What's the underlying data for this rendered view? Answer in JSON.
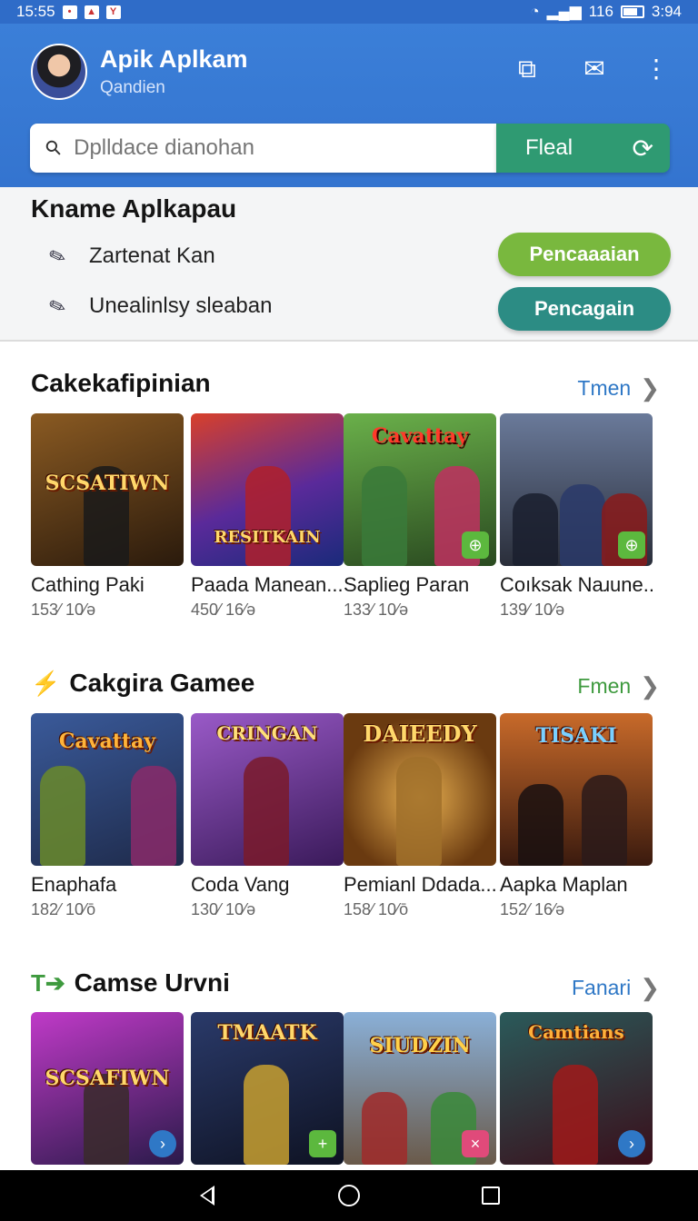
{
  "status_bar": {
    "time": "15:55",
    "signal": "116",
    "clock": "3:94"
  },
  "header": {
    "title": "Apik Aplkam",
    "subtitle": "Qandien",
    "search_placeholder": "Dplldace dianohan",
    "search_button": "Fleal",
    "icons": [
      "chat-icon",
      "mail-icon",
      "more-icon"
    ]
  },
  "filter": {
    "title": "Kname Aplkapau",
    "rows": [
      {
        "label": "Zartenat Kan",
        "button": "Pencaaaian",
        "button_color": "#79b83e"
      },
      {
        "label": "Unealinlsy sleaban",
        "button": "Pencagain",
        "button_color": "#2c8c84"
      }
    ]
  },
  "sections": [
    {
      "title": "Cakekafipinian",
      "icon": "",
      "see_more": "Tmen",
      "see_more_color": "#2f78c6",
      "items": [
        {
          "name": "Cathing Paki",
          "meta": "153⁄ 10⁄ə",
          "art": "SCSATIWN",
          "bg": "#5a3a1c",
          "badge": ""
        },
        {
          "name": "Paada Manean...",
          "meta": "450⁄ 16⁄ə",
          "art": "RESITKAIN",
          "bg": "#6a2a8a",
          "badge": ""
        },
        {
          "name": "Saplieg Paran",
          "meta": "133⁄ 10⁄ə",
          "art": "Cavattay",
          "bg": "#3f7a3b",
          "badge": "+"
        },
        {
          "name": "Coıksak Naɹune...",
          "meta": "139⁄ 10⁄ə",
          "art": "",
          "bg": "#3d4a5e",
          "badge": "+"
        }
      ]
    },
    {
      "title": "Cakgira Gamee",
      "icon": "⚡",
      "see_more": "Fmen",
      "see_more_color": "#3e9a3e",
      "items": [
        {
          "name": "Enaphafa",
          "meta": "182⁄ 10⁄ō",
          "art": "Cavattay",
          "bg": "#2f3e6a",
          "badge": ""
        },
        {
          "name": "Coda Vang",
          "meta": "130⁄ 10⁄ə",
          "art": "CRINGAN",
          "bg": "#5b2f7a",
          "badge": ""
        },
        {
          "name": "Pemianl Ddada...",
          "meta": "158⁄ 10⁄ō",
          "art": "DAIEEDY",
          "bg": "#6a4a1c",
          "badge": ""
        },
        {
          "name": "Aapka Maplan",
          "meta": "152⁄ 16⁄ə",
          "art": "TISAKI",
          "bg": "#7a3a1e",
          "badge": ""
        }
      ]
    },
    {
      "title": "Camse Urvni",
      "icon": "T➔",
      "see_more": "Fanari",
      "see_more_color": "#2f78c6",
      "items": [
        {
          "name": "",
          "meta": "",
          "art": "SCSAFIWN",
          "bg": "#4a2a6a",
          "badge": "›"
        },
        {
          "name": "",
          "meta": "",
          "art": "TMAATK",
          "bg": "#1e2a4a",
          "badge": "+"
        },
        {
          "name": "",
          "meta": "",
          "art": "SIUDZIN",
          "bg": "#4a5a7a",
          "badge": "×"
        },
        {
          "name": "",
          "meta": "",
          "art": "Camtians",
          "bg": "#3a1a2a",
          "badge": "›"
        }
      ]
    }
  ],
  "colors": {
    "header": "#3b7fd8",
    "search_button": "#2f9a72"
  }
}
